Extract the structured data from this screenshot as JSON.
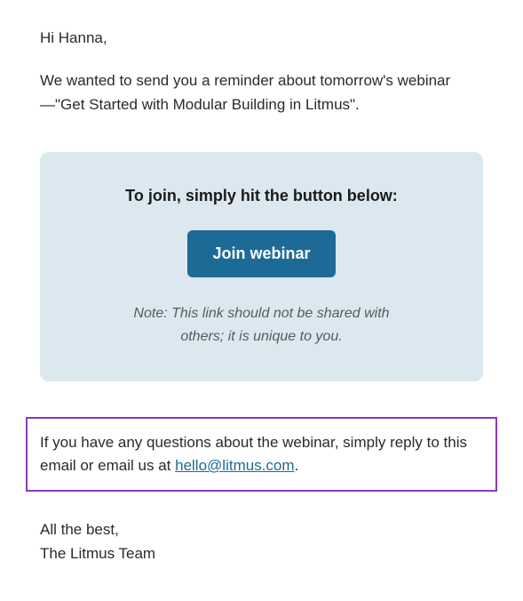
{
  "greeting": "Hi Hanna,",
  "intro": "We wanted to send you a reminder about tomorrow's webinar—\"Get Started with Modular Building in Litmus\".",
  "cta": {
    "heading": "To join, simply hit the button below:",
    "button_label": "Join webinar",
    "note": "Note: This link should not be shared with others; it is unique to you."
  },
  "questions": {
    "prefix": "If you have any questions about the webinar, simply reply to this email or email us at ",
    "email": "hello@litmus.com",
    "suffix": "."
  },
  "signoff": {
    "line1": "All the best,",
    "line2": "The Litmus Team"
  }
}
